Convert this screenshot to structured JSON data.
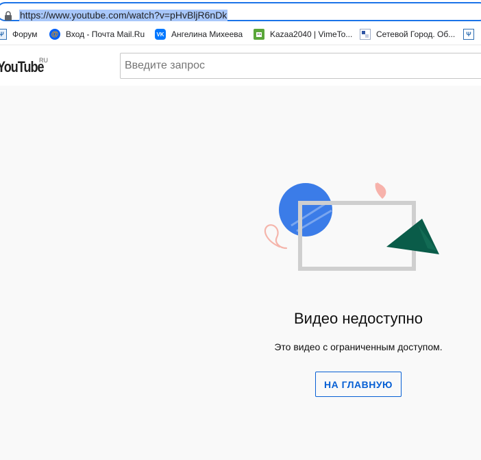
{
  "browser": {
    "url": "https://www.youtube.com/watch?v=pHvBljR6nDk",
    "accent_color": "#1a73e8"
  },
  "bookmarks": [
    {
      "label": "Форум",
      "icon": "forum-icon"
    },
    {
      "label": "Вход - Почта Mail.Ru",
      "icon": "mail-ru-icon"
    },
    {
      "label": "Ангелина Михеева",
      "icon": "vk-icon"
    },
    {
      "label": "Kazaa2040 | VimeTo...",
      "icon": "vimeto-icon"
    },
    {
      "label": "Сетевой Город. Об...",
      "icon": "netcity-icon"
    }
  ],
  "youtube": {
    "logo_text": "YouTube",
    "country_code": "RU",
    "search_placeholder": "Введите запрос"
  },
  "error": {
    "title": "Видео недоступно",
    "subtitle": "Это видео с ограниченным доступом.",
    "home_button_label": "НА ГЛАВНУЮ",
    "button_color": "#065fd4"
  }
}
